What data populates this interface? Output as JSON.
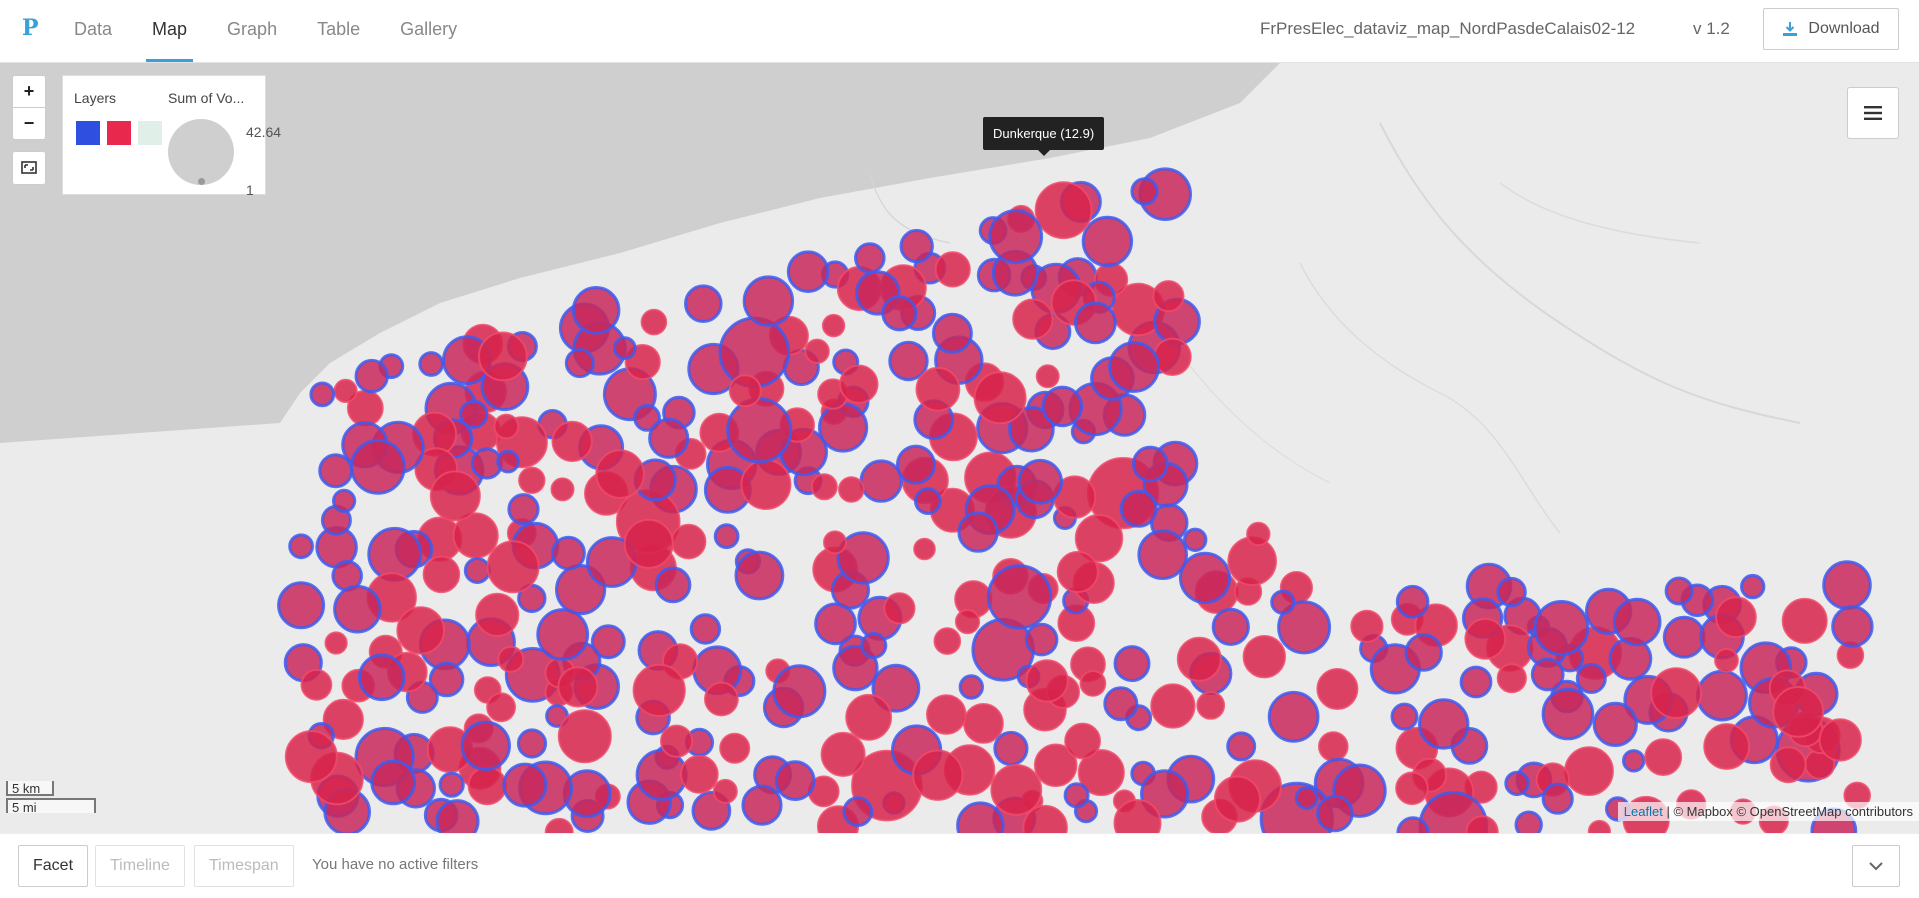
{
  "app": {
    "logo": "P",
    "nav": [
      "Data",
      "Map",
      "Graph",
      "Table",
      "Gallery"
    ],
    "active_nav": "Map",
    "file_title": "FrPresElec_dataviz_map_NordPasdeCalais02-12",
    "version": "v 1.2",
    "download_label": "Download"
  },
  "map": {
    "zoom_in": "+",
    "zoom_out": "−",
    "legend": {
      "layers_title": "Layers",
      "sum_title": "Sum of Vo...",
      "swatches": [
        "#2f4fe0",
        "#e8294d",
        "#e0efe8"
      ],
      "max_value": "42.64",
      "min_value": "1"
    },
    "tooltip": "Dunkerque (12.9)",
    "scale_km": "5 km",
    "scale_mi": "5 mi",
    "attribution_leaflet": "Leaflet",
    "attribution_rest": "| © Mapbox © OpenStreetMap contributors",
    "colors": {
      "sea": "#cfcfcf",
      "land": "#ebebeb",
      "layer_blue": "#3552e6",
      "layer_red": "#e8294d",
      "bubble_fill": "#d12c58"
    },
    "icons": [
      "zoom-in-icon",
      "zoom-out-icon",
      "fit-bounds-icon",
      "layers-menu-icon",
      "download-icon",
      "chevron-down-icon"
    ]
  },
  "filters": {
    "facet_label": "Facet",
    "timeline_label": "Timeline",
    "timespan_label": "Timespan",
    "status": "You have no active filters"
  }
}
